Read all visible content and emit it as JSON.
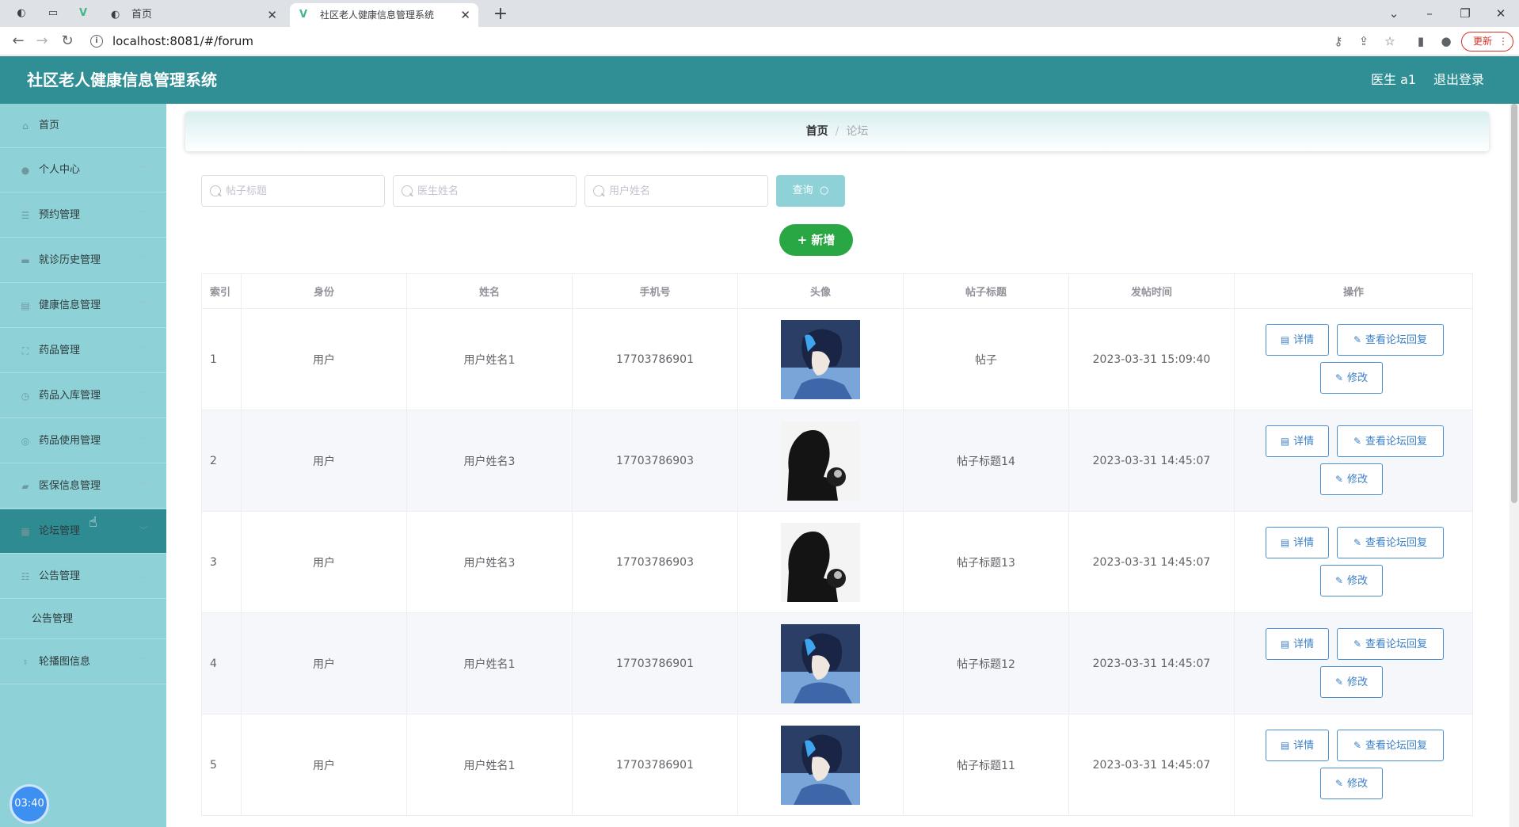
{
  "browser": {
    "tabs": [
      {
        "label": "首页",
        "active": false
      },
      {
        "label": "社区老人健康信息管理系统",
        "active": true
      }
    ],
    "url": "localhost:8081/#/forum",
    "update_label": "更新"
  },
  "header": {
    "title": "社区老人健康信息管理系统",
    "user": "医生 a1",
    "logout": "退出登录"
  },
  "sidebar": {
    "items": [
      {
        "label": "首页",
        "icon": "home-icon"
      },
      {
        "label": "个人中心",
        "icon": "user-icon"
      },
      {
        "label": "预约管理",
        "icon": "list-icon"
      },
      {
        "label": "就诊历史管理",
        "icon": "folder-icon"
      },
      {
        "label": "健康信息管理",
        "icon": "clipboard-icon"
      },
      {
        "label": "药品管理",
        "icon": "frame-icon"
      },
      {
        "label": "药品入库管理",
        "icon": "compass-icon"
      },
      {
        "label": "药品使用管理",
        "icon": "target-icon"
      },
      {
        "label": "医保信息管理",
        "icon": "chat-icon"
      },
      {
        "label": "论坛管理",
        "icon": "grid-icon",
        "active": true
      },
      {
        "label": "公告管理",
        "icon": "sliders-icon",
        "expanded": true
      },
      {
        "label": "轮播图信息",
        "icon": "mic-icon"
      }
    ],
    "sub_items": [
      {
        "label": "公告管理"
      }
    ],
    "clock": "03:40"
  },
  "breadcrumb": {
    "home": "首页",
    "separator": "/",
    "current": "论坛"
  },
  "search": {
    "title_placeholder": "帖子标题",
    "doctor_placeholder": "医生姓名",
    "user_placeholder": "用户姓名",
    "query_label": "查询",
    "add_label": "+ 新增"
  },
  "table": {
    "headers": [
      "索引",
      "身份",
      "姓名",
      "手机号",
      "头像",
      "帖子标题",
      "发帖时间",
      "操作"
    ],
    "rows": [
      {
        "index": "1",
        "role": "用户",
        "name": "用户姓名1",
        "phone": "17703786901",
        "avatar": "blue-hair-portrait",
        "title": "帖子",
        "time": "2023-03-31 15:09:40"
      },
      {
        "index": "2",
        "role": "用户",
        "name": "用户姓名3",
        "phone": "17703786903",
        "avatar": "silhouette-portrait",
        "title": "帖子标题14",
        "time": "2023-03-31 14:45:07"
      },
      {
        "index": "3",
        "role": "用户",
        "name": "用户姓名3",
        "phone": "17703786903",
        "avatar": "silhouette-portrait",
        "title": "帖子标题13",
        "time": "2023-03-31 14:45:07"
      },
      {
        "index": "4",
        "role": "用户",
        "name": "用户姓名1",
        "phone": "17703786901",
        "avatar": "blue-hair-portrait",
        "title": "帖子标题12",
        "time": "2023-03-31 14:45:07"
      },
      {
        "index": "5",
        "role": "用户",
        "name": "用户姓名1",
        "phone": "17703786901",
        "avatar": "blue-hair-portrait",
        "title": "帖子标题11",
        "time": "2023-03-31 14:45:07"
      }
    ],
    "actions": {
      "detail": "详情",
      "reply": "查看论坛回复",
      "edit": "修改"
    }
  },
  "colors": {
    "header_bg": "#2f8f94",
    "sidebar_bg": "#8ed2d8",
    "sidebar_active": "#2e8b91",
    "add_button": "#2aa745",
    "action_border": "#4a8fd1"
  }
}
